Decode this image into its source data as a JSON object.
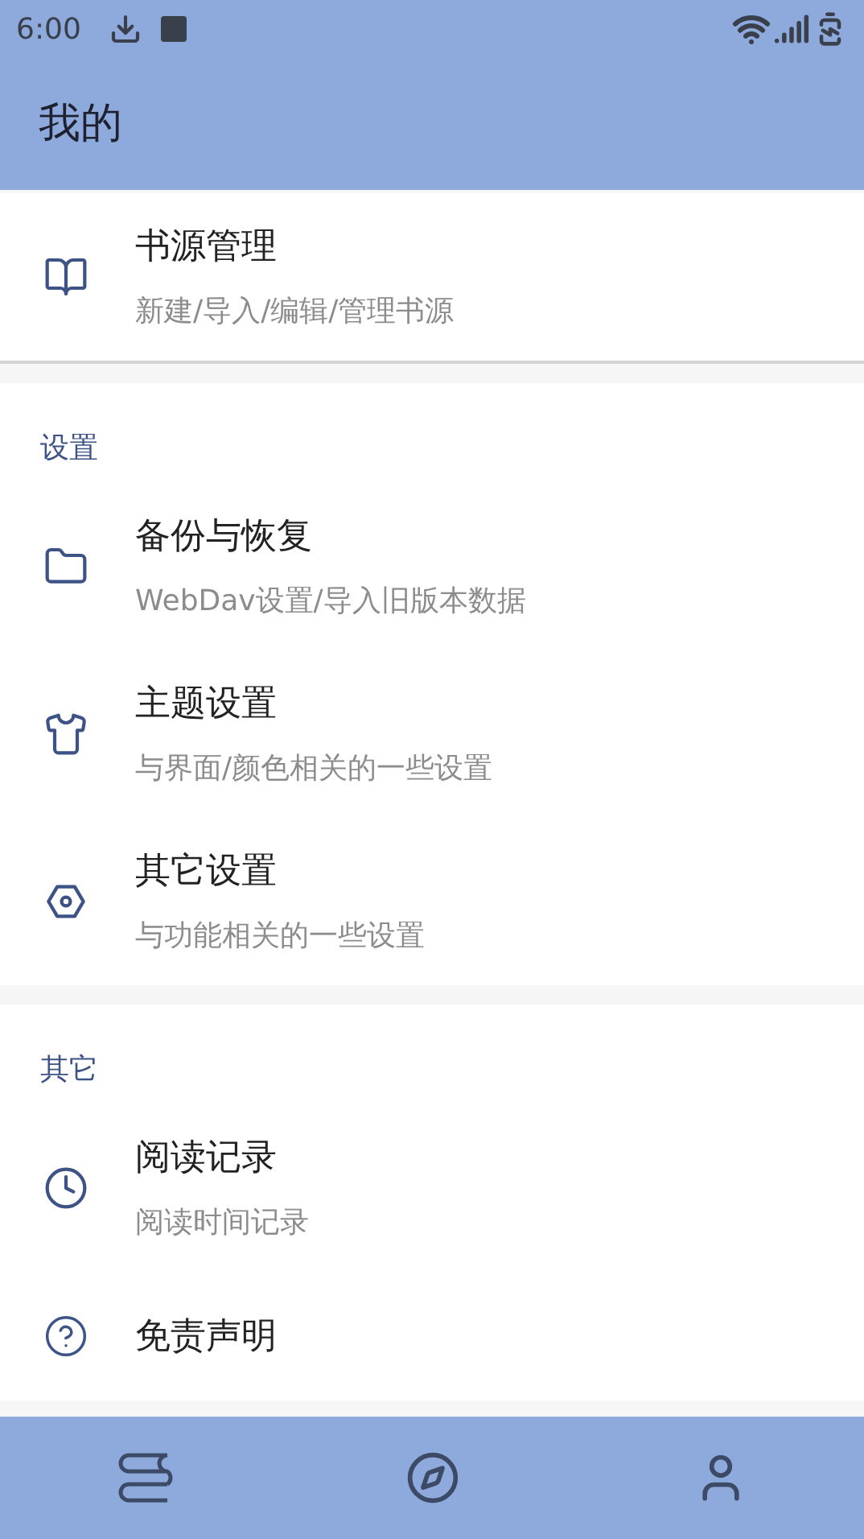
{
  "status_bar": {
    "time": "6:00"
  },
  "app_bar": {
    "title": "我的"
  },
  "sections": [
    {
      "items": [
        {
          "title": "书源管理",
          "subtitle": "新建/导入/编辑/管理书源"
        }
      ]
    },
    {
      "header": "设置",
      "items": [
        {
          "title": "备份与恢复",
          "subtitle": "WebDav设置/导入旧版本数据"
        },
        {
          "title": "主题设置",
          "subtitle": "与界面/颜色相关的一些设置"
        },
        {
          "title": "其它设置",
          "subtitle": "与功能相关的一些设置"
        }
      ]
    },
    {
      "header": "其它",
      "items": [
        {
          "title": "阅读记录",
          "subtitle": "阅读时间记录"
        },
        {
          "title": "免责声明"
        }
      ]
    }
  ]
}
